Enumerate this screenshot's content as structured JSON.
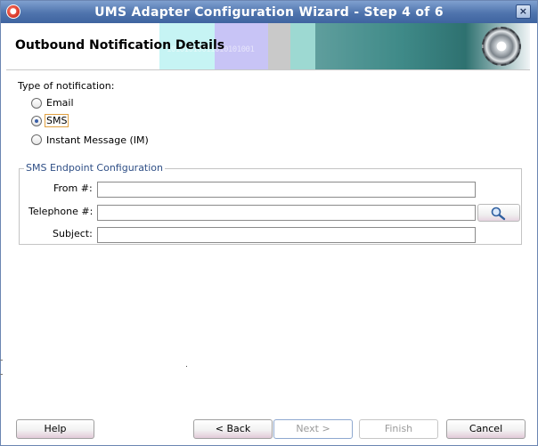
{
  "window": {
    "title": "UMS Adapter Configuration Wizard - Step 4 of 6",
    "close_glyph": "×",
    "app_icon": "oracle-logo-icon"
  },
  "header": {
    "title": "Outbound Notification Details"
  },
  "notification": {
    "label": "Type of notification:",
    "options": [
      "Email",
      "SMS",
      "Instant Message (IM)"
    ],
    "selected": "SMS"
  },
  "sms_config": {
    "legend": "SMS Endpoint Configuration",
    "from_label": "From #:",
    "from_value": "",
    "telephone_label": "Telephone #:",
    "telephone_value": "",
    "subject_label": "Subject:",
    "subject_value": "",
    "search_icon": "magnifier-icon"
  },
  "buttons": {
    "help": "Help",
    "back": "< Back",
    "next": "Next >",
    "finish": "Finish",
    "cancel": "Cancel"
  },
  "colors": {
    "titlebar": "#4f74ad",
    "legend_text": "#2f4f86",
    "focus_border": "#e0a040"
  }
}
